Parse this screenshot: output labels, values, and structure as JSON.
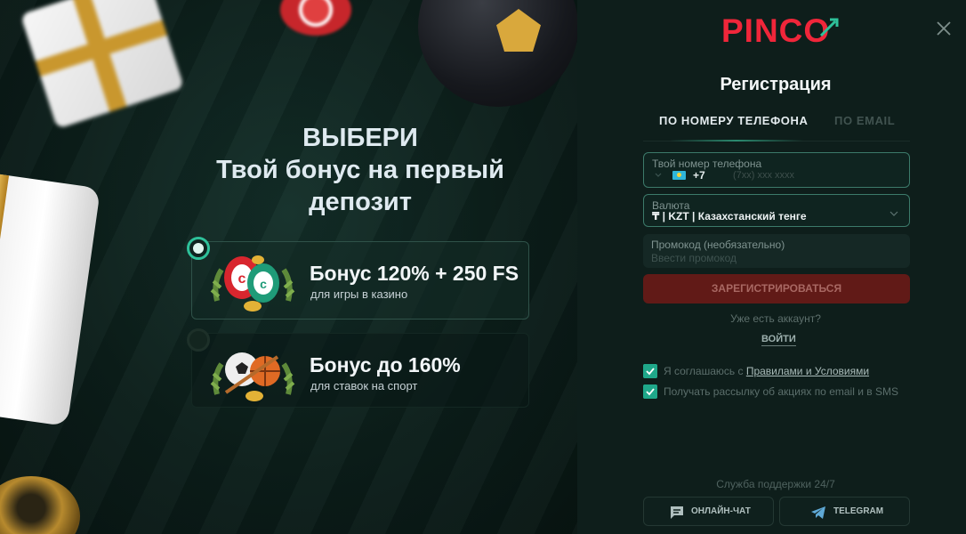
{
  "promo": {
    "title_line1": "ВЫБЕРИ",
    "title_line2": "Твой бонус на первый",
    "title_line3": "депозит",
    "bonuses": [
      {
        "title": "Бонус 120% + 250 FS",
        "subtitle": "для игры в казино",
        "selected": true
      },
      {
        "title": "Бонус до 160%",
        "subtitle": "для ставок на спорт",
        "selected": false
      }
    ]
  },
  "form": {
    "logo": "PINCO",
    "title": "Регистрация",
    "tabs": [
      {
        "label": "ПО НОМЕРУ ТЕЛЕФОНА",
        "active": true
      },
      {
        "label": "ПО EMAIL",
        "active": false
      }
    ],
    "phone": {
      "label": "Твой номер телефона",
      "prefix": "+7",
      "placeholder": "(7xx) xxx xxxx",
      "value": ""
    },
    "currency": {
      "label": "Валюта",
      "value": "₸ | KZT | Казахстанский тенге"
    },
    "promo_code": {
      "label": "Промокод (необязательно)",
      "placeholder": "Ввести промокод",
      "value": ""
    },
    "register_button": "ЗАРЕГИСТРИРОВАТЬСЯ",
    "have_account": "Уже есть аккаунт?",
    "login_link": "ВОЙТИ",
    "agreement": {
      "prefix": "Я соглашаюсь с ",
      "link": "Правилами и Условиями",
      "checked": true
    },
    "newsletter": {
      "text": "Получать рассылку об акциях по email и в SMS",
      "checked": true
    },
    "support": {
      "title": "Служба поддержки 24/7",
      "chat_label": "ОНЛАЙН-ЧАТ",
      "telegram_label": "TELEGRAM"
    }
  },
  "colors": {
    "brand_red": "#f0263a",
    "accent_green": "#2ec19a",
    "register_bg": "#611a17"
  }
}
